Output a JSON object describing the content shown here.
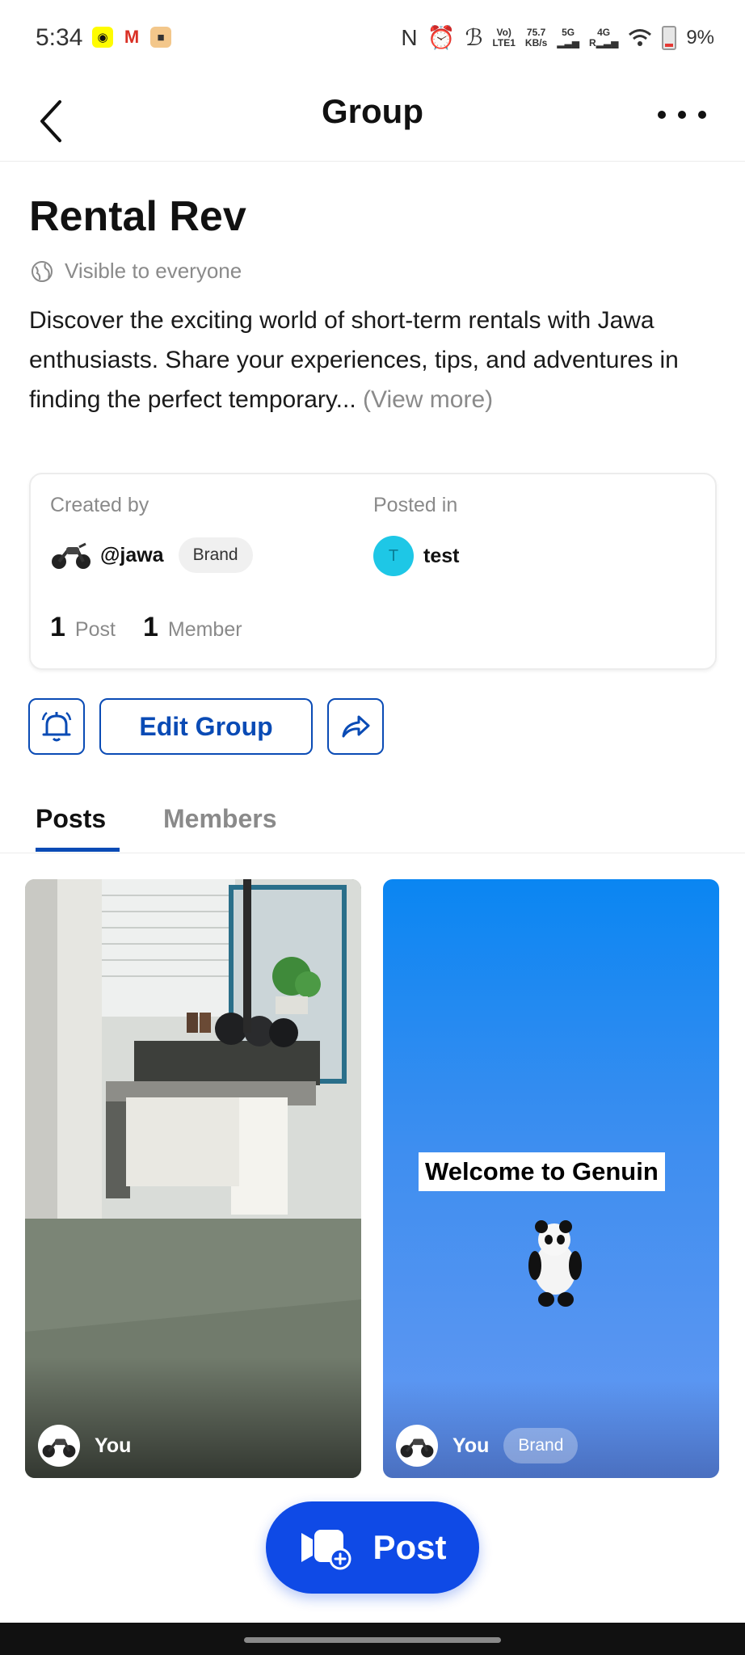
{
  "status_bar": {
    "time": "5:34",
    "network_speed_value": "75.7",
    "network_speed_unit": "KB/s",
    "volte": "Vo)",
    "lte": "LTE1",
    "sim1": "5G",
    "sim2": "4G",
    "battery": "9%"
  },
  "header": {
    "title": "Group"
  },
  "group": {
    "name": "Rental Rev",
    "visibility": "Visible to everyone",
    "description": "Discover the exciting world of short-term rentals with Jawa enthusiasts. Share your experiences, tips, and adventures in finding the perfect temporary...",
    "view_more": "(View more)"
  },
  "info_card": {
    "created_by_label": "Created by",
    "creator_handle": "@jawa",
    "creator_badge": "Brand",
    "posted_in_label": "Posted in",
    "channel_initial": "T",
    "channel_name": "test",
    "post_count": "1",
    "post_label": "Post",
    "member_count": "1",
    "member_label": "Member"
  },
  "actions": {
    "edit_label": "Edit Group"
  },
  "tabs": [
    {
      "label": "Posts",
      "active": true
    },
    {
      "label": "Members",
      "active": false
    }
  ],
  "posts": [
    {
      "author": "You",
      "badge": ""
    },
    {
      "author": "You",
      "badge": "Brand",
      "overlay_text": "Welcome to Genuin"
    }
  ],
  "fab": {
    "label": "Post"
  },
  "colors": {
    "accent": "#0a4bb5",
    "fab": "#0f4ae6",
    "muted_text": "#8a8a8a",
    "channel_avatar": "#1ec7e6"
  }
}
